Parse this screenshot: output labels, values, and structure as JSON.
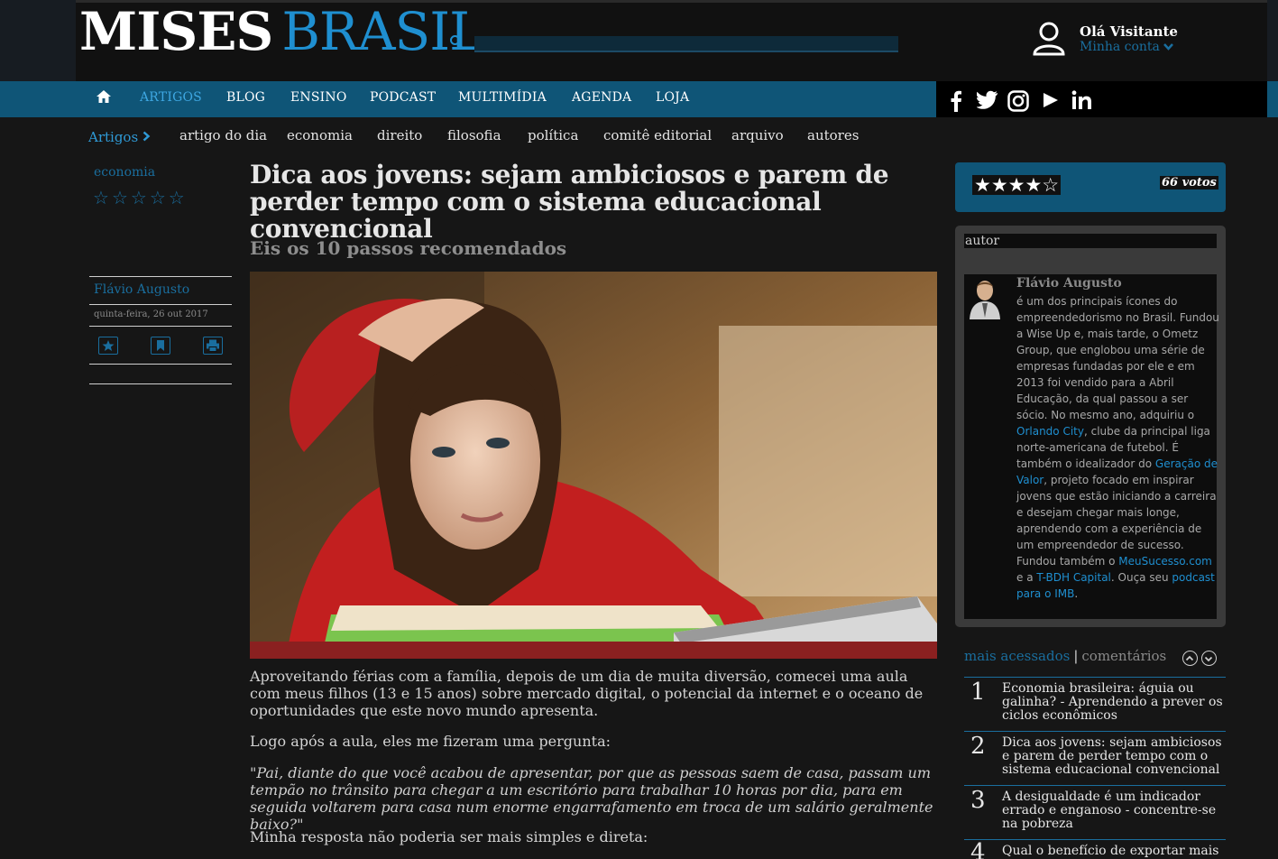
{
  "header": {
    "logo_primary": "MISES",
    "logo_secondary": "BRASIL",
    "search_placeholder": "",
    "greeting": "Olá Visitante",
    "account_link": "Minha conta"
  },
  "nav": {
    "items": [
      "ARTIGOS",
      "BLOG",
      "ENSINO",
      "PODCAST",
      "MULTIMÍDIA",
      "AGENDA",
      "LOJA"
    ],
    "active": "ARTIGOS",
    "social": [
      "facebook",
      "twitter",
      "instagram",
      "youtube",
      "linkedin"
    ]
  },
  "subnav": {
    "label": "Artigos",
    "items": [
      "artigo do dia",
      "economia",
      "direito",
      "filosofia",
      "política",
      "comitê editorial",
      "arquivo",
      "autores"
    ]
  },
  "left": {
    "category": "economia",
    "author": "Flávio Augusto",
    "date": "quinta-feira, 26 out 2017",
    "rating_stars": 0
  },
  "article": {
    "title": "Dica aos jovens: sejam ambiciosos e parem de perder tempo com o sistema educacional convencional",
    "subtitle": "Eis os 10 passos recomendados",
    "paragraphs": [
      "Aproveitando férias com a família, depois de um dia de muita diversão, comecei uma aula com meus filhos (13 e 15 anos) sobre mercado digital, o potencial da internet e o oceano de oportunidades que este novo mundo apresenta.",
      "Logo após a aula, eles me fizeram uma pergunta:",
      "\"Pai, diante do que você acabou de apresentar, por que as pessoas saem de casa, passam um tempão no trânsito para chegar a um escritório para trabalhar 10 horas por dia, para em seguida voltarem para casa num enorme engarrafamento em troca de um salário geralmente baixo?\"",
      "Minha resposta não poderia ser mais simples e direta:"
    ]
  },
  "rating": {
    "stars_text": "★★★★☆",
    "votes": "66 votos"
  },
  "author_box": {
    "label": "autor",
    "name": "Flávio Augusto",
    "bio_1": "é um dos principais ícones do empreendedorismo no Brasil. Fundou a Wise Up e, mais tarde, o Ometz Group, que englobou uma série de empresas fundadas por ele e em 2013 foi vendido para a Abril Educação, da qual passou a ser sócio. No mesmo ano, adquiriu o ",
    "link_1": "Orlando City",
    "bio_2": ", clube da principal liga norte-americana de futebol. É também o idealizador do ",
    "link_2": "Geração de Valor",
    "bio_3": ", projeto focado em inspirar jovens que estão iniciando a carreira e desejam chegar mais longe, aprendendo com a experiência de um empreendedor de sucesso. Fundou também o ",
    "link_3": "MeuSucesso.com",
    "bio_4": " e a ",
    "link_4": "T-BDH Capital",
    "bio_5": ". Ouça seu ",
    "link_5": "podcast para o IMB",
    "bio_6": "."
  },
  "popular": {
    "tab_active": "mais acessados",
    "tab_sep": "|",
    "tab_other": "comentários",
    "items": [
      {
        "num": "1",
        "title": "Economia brasileira: águia ou galinha? - Aprendendo a prever os ciclos econômicos"
      },
      {
        "num": "2",
        "title": "Dica aos jovens: sejam ambiciosos e parem de perder tempo com o sistema educacional convencional"
      },
      {
        "num": "3",
        "title": "A desigualdade é um indicador errado e enganoso - concentre-se na pobreza"
      },
      {
        "num": "4",
        "title": "Qual o benefício de exportar mais"
      }
    ]
  }
}
